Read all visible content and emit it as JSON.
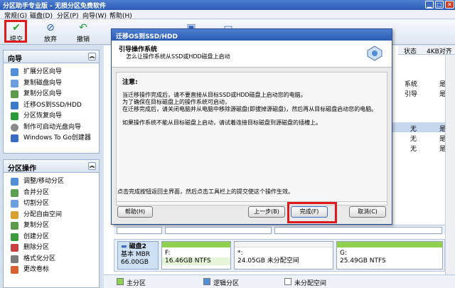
{
  "window": {
    "title": "分区助手专业版 - 无损分区免费软件"
  },
  "menu": [
    "常规(G)",
    "磁盘(D)",
    "分区(P)",
    "向导(W)",
    "帮助(H)"
  ],
  "toolbar": {
    "submit": "提交",
    "discard": "放弃",
    "undo": "撤销"
  },
  "sidebar": {
    "wizard": {
      "title": "向导",
      "items": [
        "扩展分区向导",
        "复制磁盘向导",
        "复制分区向导",
        "迁移OS到SSD/HDD",
        "分区恢复向导",
        "制作可启动光盘向导",
        "Windows To Go创建器"
      ]
    },
    "ops": {
      "title": "分区操作",
      "items": [
        "调整/移动分区",
        "合并分区",
        "切割分区",
        "分配自由空间",
        "复制分区",
        "创建分区",
        "删除分区",
        "格式化分区",
        "更改卷标"
      ]
    }
  },
  "table": {
    "headers": [
      "状态",
      "4KB对齐"
    ],
    "rows": [
      [
        "系统",
        "是"
      ],
      [
        "引导",
        "是"
      ],
      [
        "无",
        "是"
      ],
      [
        "无",
        "是"
      ],
      [
        "无",
        "是"
      ]
    ]
  },
  "disk2": {
    "name": "磁盘2",
    "type": "基本 MBR",
    "size": "66.00GB",
    "partitions": [
      {
        "letter": "F:",
        "info": "16.46GB NTFS"
      },
      {
        "letter": "*:",
        "info": "24.05GB 未分配空间"
      },
      {
        "letter": "G:",
        "info": "25.49GB NTFS"
      }
    ]
  },
  "legend": {
    "primary": "主分区",
    "logical": "逻辑分区",
    "unallocated": "未分配空间"
  },
  "dialog": {
    "title": "迁移OS到SSD/HDD",
    "head_title": "引导操作系统",
    "head_sub": "怎么让操作系统从SSD或HDD磁盘上启动",
    "note_title": "注意:",
    "lines": [
      "当迁移操作完成后，请不要直接从目标SSD或HDD磁盘上启动您的电脑。",
      "为了确保在目标磁盘上的操作系统可启动，",
      "在迁移完成后，请关闭电脑并从电脑中移除源磁盘(即拔掉源磁盘)，然后再从目标磁盘启动您的电脑。",
      "如果操作系统不能从目标磁盘上启动，请试着连接目标磁盘到源磁盘的插槽上。"
    ],
    "footer_hint": "点击完成按钮返回主界面，然后点击工具栏上的提交使这个操作生效。",
    "buttons": {
      "help": "帮助(H)",
      "back": "上一步(B)",
      "finish": "完成(F)",
      "cancel": "取消(C)"
    }
  },
  "colors": {
    "highlight": "#e01a1a",
    "title_blue": "#2a5ab4",
    "partition_green": "#8fd14f",
    "partition_blue": "#4f8fd8"
  }
}
